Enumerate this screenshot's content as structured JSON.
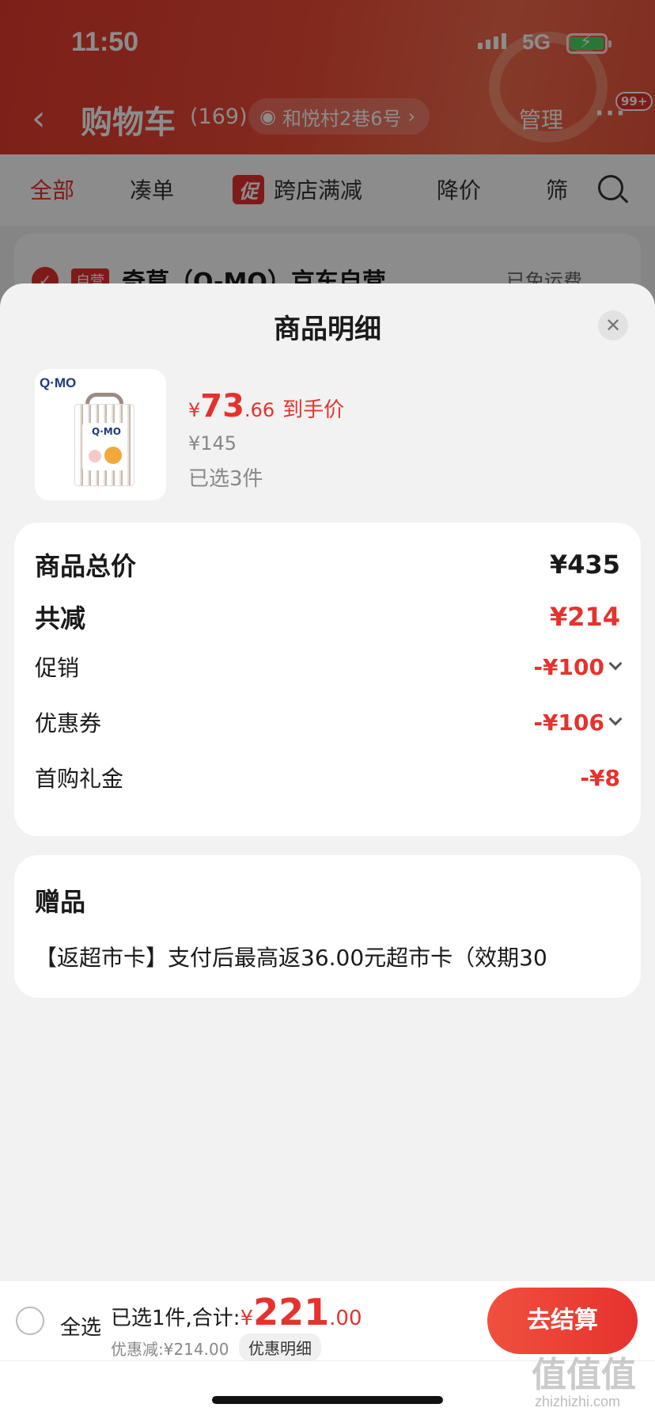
{
  "status_bar": {
    "time": "11:50",
    "network": "5G"
  },
  "nav": {
    "title": "购物车",
    "count": "(169)",
    "address": "和悦村2巷6号",
    "manage": "管理",
    "more_badge": "99+"
  },
  "tabs": [
    {
      "label": "全部"
    },
    {
      "label": "凑单"
    },
    {
      "label": "跨店满减",
      "tag": "促"
    },
    {
      "label": "降价"
    },
    {
      "label": "筛"
    }
  ],
  "store": {
    "tag": "自营",
    "name": "奇莫（Q-MO）京东自营",
    "shipping": "已免运费"
  },
  "sheet": {
    "title": "商品明细",
    "product": {
      "logo": "Q·MO",
      "currency": "¥",
      "price_int": "73",
      "price_dec": ".66",
      "price_label": "到手价",
      "original_price": "¥145",
      "quantity": "已选3件"
    },
    "summary": {
      "total": {
        "label": "商品总价",
        "value": "¥435"
      },
      "discount": {
        "label": "共减",
        "value": "¥214"
      },
      "promotion": {
        "label": "促销",
        "value": "-¥100"
      },
      "coupon": {
        "label": "优惠券",
        "value": "-¥106"
      },
      "first_gift": {
        "label": "首购礼金",
        "value": "-¥8"
      }
    },
    "gifts": {
      "title": "赠品",
      "description": "【返超市卡】支付后最高返36.00元超市卡（效期30"
    }
  },
  "bottom_bar": {
    "select_all": "全选",
    "selected_text": "已选1件,合计:",
    "currency": "¥",
    "total_int": "221",
    "total_dec": ".00",
    "saving": "优惠减:¥214.00",
    "detail_link": "优惠明细",
    "checkout": "去结算"
  },
  "watermark": {
    "main": "值值值",
    "sub": "zhizhizhi.com"
  },
  "colors": {
    "accent": "#e6322e",
    "header": "#e23a2e",
    "sheet_bg": "#f2f2f2"
  }
}
